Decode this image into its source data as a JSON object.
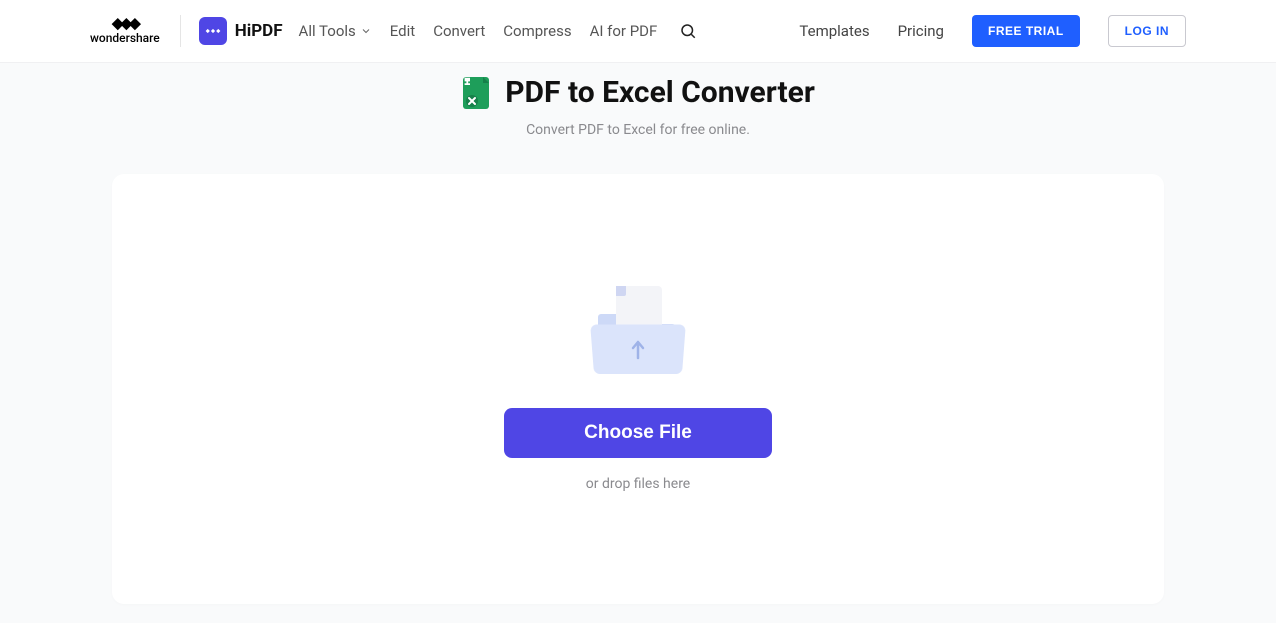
{
  "brand": {
    "parent": "wondershare",
    "product": "HiPDF"
  },
  "nav": {
    "allTools": "All Tools",
    "edit": "Edit",
    "convert": "Convert",
    "compress": "Compress",
    "ai": "AI for PDF",
    "templates": "Templates",
    "pricing": "Pricing",
    "trial": "FREE TRIAL",
    "login": "LOG IN"
  },
  "page": {
    "title": "PDF to Excel Converter",
    "subtitle": "Convert PDF to Excel for free online."
  },
  "upload": {
    "choose": "Choose File",
    "hint": "or drop files here"
  }
}
